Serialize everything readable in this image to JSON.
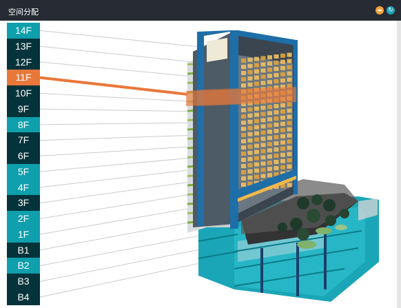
{
  "window": {
    "title": "空间分配",
    "minimize_icon": "minus-icon",
    "refresh_icon": "refresh-icon"
  },
  "floors": [
    {
      "label": "14F",
      "style": "teal"
    },
    {
      "label": "13F",
      "style": "dark"
    },
    {
      "label": "12F",
      "style": "dark"
    },
    {
      "label": "11F",
      "style": "active"
    },
    {
      "label": "10F",
      "style": "dark"
    },
    {
      "label": "9F",
      "style": "dark"
    },
    {
      "label": "8F",
      "style": "teal"
    },
    {
      "label": "7F",
      "style": "dark"
    },
    {
      "label": "6F",
      "style": "dark"
    },
    {
      "label": "5F",
      "style": "teal"
    },
    {
      "label": "4F",
      "style": "teal"
    },
    {
      "label": "3F",
      "style": "dark"
    },
    {
      "label": "2F",
      "style": "teal"
    },
    {
      "label": "1F",
      "style": "teal"
    },
    {
      "label": "B1",
      "style": "dark"
    },
    {
      "label": "B2",
      "style": "teal"
    },
    {
      "label": "B3",
      "style": "dark"
    },
    {
      "label": "B4",
      "style": "dark"
    }
  ],
  "selected_floor": "11F",
  "colors": {
    "teal": "#0f9fad",
    "dark": "#05333b",
    "active": "#e8783a",
    "titlebar": "#262b33"
  }
}
